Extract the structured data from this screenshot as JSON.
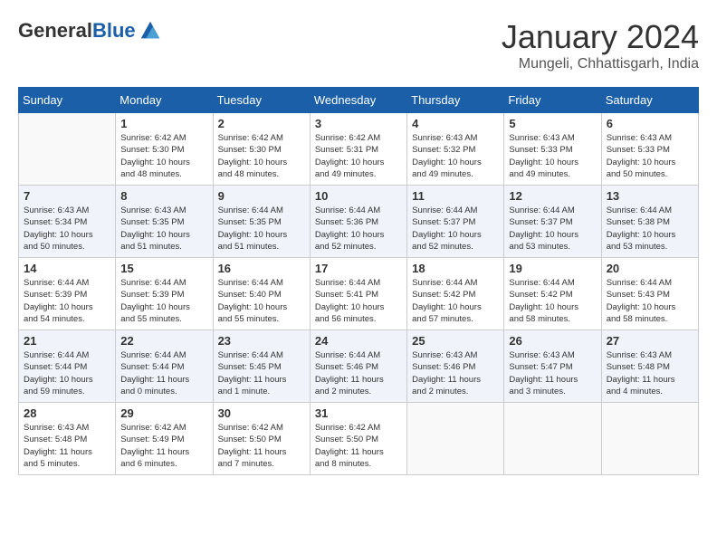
{
  "header": {
    "logo_general": "General",
    "logo_blue": "Blue",
    "month_title": "January 2024",
    "location": "Mungeli, Chhattisgarh, India"
  },
  "calendar": {
    "days_of_week": [
      "Sunday",
      "Monday",
      "Tuesday",
      "Wednesday",
      "Thursday",
      "Friday",
      "Saturday"
    ],
    "weeks": [
      [
        {
          "day": "",
          "info": ""
        },
        {
          "day": "1",
          "info": "Sunrise: 6:42 AM\nSunset: 5:30 PM\nDaylight: 10 hours\nand 48 minutes."
        },
        {
          "day": "2",
          "info": "Sunrise: 6:42 AM\nSunset: 5:30 PM\nDaylight: 10 hours\nand 48 minutes."
        },
        {
          "day": "3",
          "info": "Sunrise: 6:42 AM\nSunset: 5:31 PM\nDaylight: 10 hours\nand 49 minutes."
        },
        {
          "day": "4",
          "info": "Sunrise: 6:43 AM\nSunset: 5:32 PM\nDaylight: 10 hours\nand 49 minutes."
        },
        {
          "day": "5",
          "info": "Sunrise: 6:43 AM\nSunset: 5:33 PM\nDaylight: 10 hours\nand 49 minutes."
        },
        {
          "day": "6",
          "info": "Sunrise: 6:43 AM\nSunset: 5:33 PM\nDaylight: 10 hours\nand 50 minutes."
        }
      ],
      [
        {
          "day": "7",
          "info": "Sunrise: 6:43 AM\nSunset: 5:34 PM\nDaylight: 10 hours\nand 50 minutes."
        },
        {
          "day": "8",
          "info": "Sunrise: 6:43 AM\nSunset: 5:35 PM\nDaylight: 10 hours\nand 51 minutes."
        },
        {
          "day": "9",
          "info": "Sunrise: 6:44 AM\nSunset: 5:35 PM\nDaylight: 10 hours\nand 51 minutes."
        },
        {
          "day": "10",
          "info": "Sunrise: 6:44 AM\nSunset: 5:36 PM\nDaylight: 10 hours\nand 52 minutes."
        },
        {
          "day": "11",
          "info": "Sunrise: 6:44 AM\nSunset: 5:37 PM\nDaylight: 10 hours\nand 52 minutes."
        },
        {
          "day": "12",
          "info": "Sunrise: 6:44 AM\nSunset: 5:37 PM\nDaylight: 10 hours\nand 53 minutes."
        },
        {
          "day": "13",
          "info": "Sunrise: 6:44 AM\nSunset: 5:38 PM\nDaylight: 10 hours\nand 53 minutes."
        }
      ],
      [
        {
          "day": "14",
          "info": "Sunrise: 6:44 AM\nSunset: 5:39 PM\nDaylight: 10 hours\nand 54 minutes."
        },
        {
          "day": "15",
          "info": "Sunrise: 6:44 AM\nSunset: 5:39 PM\nDaylight: 10 hours\nand 55 minutes."
        },
        {
          "day": "16",
          "info": "Sunrise: 6:44 AM\nSunset: 5:40 PM\nDaylight: 10 hours\nand 55 minutes."
        },
        {
          "day": "17",
          "info": "Sunrise: 6:44 AM\nSunset: 5:41 PM\nDaylight: 10 hours\nand 56 minutes."
        },
        {
          "day": "18",
          "info": "Sunrise: 6:44 AM\nSunset: 5:42 PM\nDaylight: 10 hours\nand 57 minutes."
        },
        {
          "day": "19",
          "info": "Sunrise: 6:44 AM\nSunset: 5:42 PM\nDaylight: 10 hours\nand 58 minutes."
        },
        {
          "day": "20",
          "info": "Sunrise: 6:44 AM\nSunset: 5:43 PM\nDaylight: 10 hours\nand 58 minutes."
        }
      ],
      [
        {
          "day": "21",
          "info": "Sunrise: 6:44 AM\nSunset: 5:44 PM\nDaylight: 10 hours\nand 59 minutes."
        },
        {
          "day": "22",
          "info": "Sunrise: 6:44 AM\nSunset: 5:44 PM\nDaylight: 11 hours\nand 0 minutes."
        },
        {
          "day": "23",
          "info": "Sunrise: 6:44 AM\nSunset: 5:45 PM\nDaylight: 11 hours\nand 1 minute."
        },
        {
          "day": "24",
          "info": "Sunrise: 6:44 AM\nSunset: 5:46 PM\nDaylight: 11 hours\nand 2 minutes."
        },
        {
          "day": "25",
          "info": "Sunrise: 6:43 AM\nSunset: 5:46 PM\nDaylight: 11 hours\nand 2 minutes."
        },
        {
          "day": "26",
          "info": "Sunrise: 6:43 AM\nSunset: 5:47 PM\nDaylight: 11 hours\nand 3 minutes."
        },
        {
          "day": "27",
          "info": "Sunrise: 6:43 AM\nSunset: 5:48 PM\nDaylight: 11 hours\nand 4 minutes."
        }
      ],
      [
        {
          "day": "28",
          "info": "Sunrise: 6:43 AM\nSunset: 5:48 PM\nDaylight: 11 hours\nand 5 minutes."
        },
        {
          "day": "29",
          "info": "Sunrise: 6:42 AM\nSunset: 5:49 PM\nDaylight: 11 hours\nand 6 minutes."
        },
        {
          "day": "30",
          "info": "Sunrise: 6:42 AM\nSunset: 5:50 PM\nDaylight: 11 hours\nand 7 minutes."
        },
        {
          "day": "31",
          "info": "Sunrise: 6:42 AM\nSunset: 5:50 PM\nDaylight: 11 hours\nand 8 minutes."
        },
        {
          "day": "",
          "info": ""
        },
        {
          "day": "",
          "info": ""
        },
        {
          "day": "",
          "info": ""
        }
      ]
    ]
  }
}
